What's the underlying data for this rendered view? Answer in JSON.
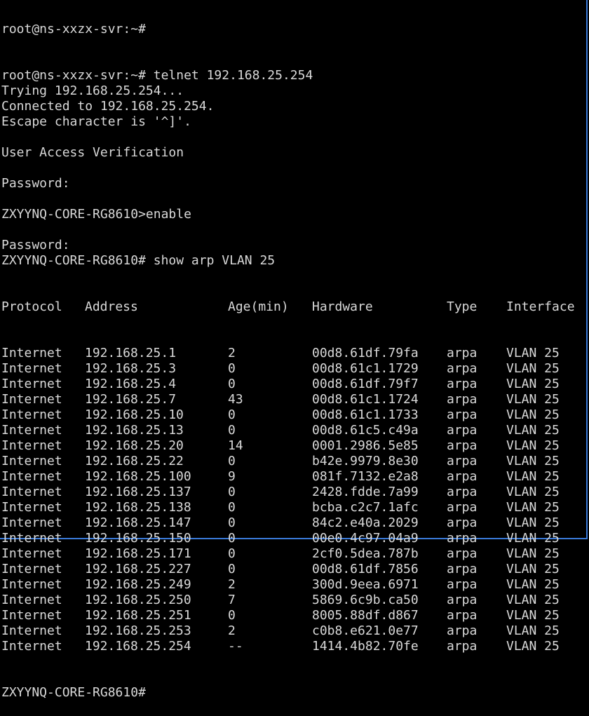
{
  "terminal": {
    "top_partial": "root@ns-xxzx-svr:~#",
    "lines": [
      "root@ns-xxzx-svr:~# telnet 192.168.25.254",
      "Trying 192.168.25.254...",
      "Connected to 192.168.25.254.",
      "Escape character is '^]'.",
      "",
      "User Access Verification",
      "",
      "Password:",
      "",
      "ZXYYNQ-CORE-RG8610>enable",
      "",
      "Password:",
      "ZXYYNQ-CORE-RG8610# show arp VLAN 25"
    ],
    "bottom_partial": "ZXYYNQ-CORE-RG8610#"
  },
  "arp": {
    "headers": {
      "protocol": "Protocol",
      "address": "Address",
      "age": "Age(min)",
      "hardware": "Hardware",
      "type": "Type",
      "interface": "Interface"
    },
    "rows": [
      {
        "protocol": "Internet",
        "address": "192.168.25.1",
        "age": "2",
        "hardware": "00d8.61df.79fa",
        "type": "arpa",
        "interface": "VLAN 25"
      },
      {
        "protocol": "Internet",
        "address": "192.168.25.3",
        "age": "0",
        "hardware": "00d8.61c1.1729",
        "type": "arpa",
        "interface": "VLAN 25"
      },
      {
        "protocol": "Internet",
        "address": "192.168.25.4",
        "age": "0",
        "hardware": "00d8.61df.79f7",
        "type": "arpa",
        "interface": "VLAN 25"
      },
      {
        "protocol": "Internet",
        "address": "192.168.25.7",
        "age": "43",
        "hardware": "00d8.61c1.1724",
        "type": "arpa",
        "interface": "VLAN 25"
      },
      {
        "protocol": "Internet",
        "address": "192.168.25.10",
        "age": "0",
        "hardware": "00d8.61c1.1733",
        "type": "arpa",
        "interface": "VLAN 25"
      },
      {
        "protocol": "Internet",
        "address": "192.168.25.13",
        "age": "0",
        "hardware": "00d8.61c5.c49a",
        "type": "arpa",
        "interface": "VLAN 25"
      },
      {
        "protocol": "Internet",
        "address": "192.168.25.20",
        "age": "14",
        "hardware": "0001.2986.5e85",
        "type": "arpa",
        "interface": "VLAN 25"
      },
      {
        "protocol": "Internet",
        "address": "192.168.25.22",
        "age": "0",
        "hardware": "b42e.9979.8e30",
        "type": "arpa",
        "interface": "VLAN 25"
      },
      {
        "protocol": "Internet",
        "address": "192.168.25.100",
        "age": "9",
        "hardware": "081f.7132.e2a8",
        "type": "arpa",
        "interface": "VLAN 25"
      },
      {
        "protocol": "Internet",
        "address": "192.168.25.137",
        "age": "0",
        "hardware": "2428.fdde.7a99",
        "type": "arpa",
        "interface": "VLAN 25"
      },
      {
        "protocol": "Internet",
        "address": "192.168.25.138",
        "age": "0",
        "hardware": "bcba.c2c7.1afc",
        "type": "arpa",
        "interface": "VLAN 25"
      },
      {
        "protocol": "Internet",
        "address": "192.168.25.147",
        "age": "0",
        "hardware": "84c2.e40a.2029",
        "type": "arpa",
        "interface": "VLAN 25"
      },
      {
        "protocol": "Internet",
        "address": "192.168.25.150",
        "age": "0",
        "hardware": "00e0.4c97.04a9",
        "type": "arpa",
        "interface": "VLAN 25"
      },
      {
        "protocol": "Internet",
        "address": "192.168.25.171",
        "age": "0",
        "hardware": "2cf0.5dea.787b",
        "type": "arpa",
        "interface": "VLAN 25"
      },
      {
        "protocol": "Internet",
        "address": "192.168.25.227",
        "age": "0",
        "hardware": "00d8.61df.7856",
        "type": "arpa",
        "interface": "VLAN 25"
      },
      {
        "protocol": "Internet",
        "address": "192.168.25.249",
        "age": "2",
        "hardware": "300d.9eea.6971",
        "type": "arpa",
        "interface": "VLAN 25"
      },
      {
        "protocol": "Internet",
        "address": "192.168.25.250",
        "age": "7",
        "hardware": "5869.6c9b.ca50",
        "type": "arpa",
        "interface": "VLAN 25"
      },
      {
        "protocol": "Internet",
        "address": "192.168.25.251",
        "age": "0",
        "hardware": "8005.88df.d867",
        "type": "arpa",
        "interface": "VLAN 25"
      },
      {
        "protocol": "Internet",
        "address": "192.168.25.253",
        "age": "2",
        "hardware": "c0b8.e621.0e77",
        "type": "arpa",
        "interface": "VLAN 25"
      },
      {
        "protocol": "Internet",
        "address": "192.168.25.254",
        "age": "--",
        "hardware": "1414.4b82.70fe",
        "type": "arpa",
        "interface": "VLAN 25"
      }
    ]
  },
  "colors": {
    "background": "#000000",
    "text": "#d9d9d9",
    "frame": "#3a7ad9"
  }
}
